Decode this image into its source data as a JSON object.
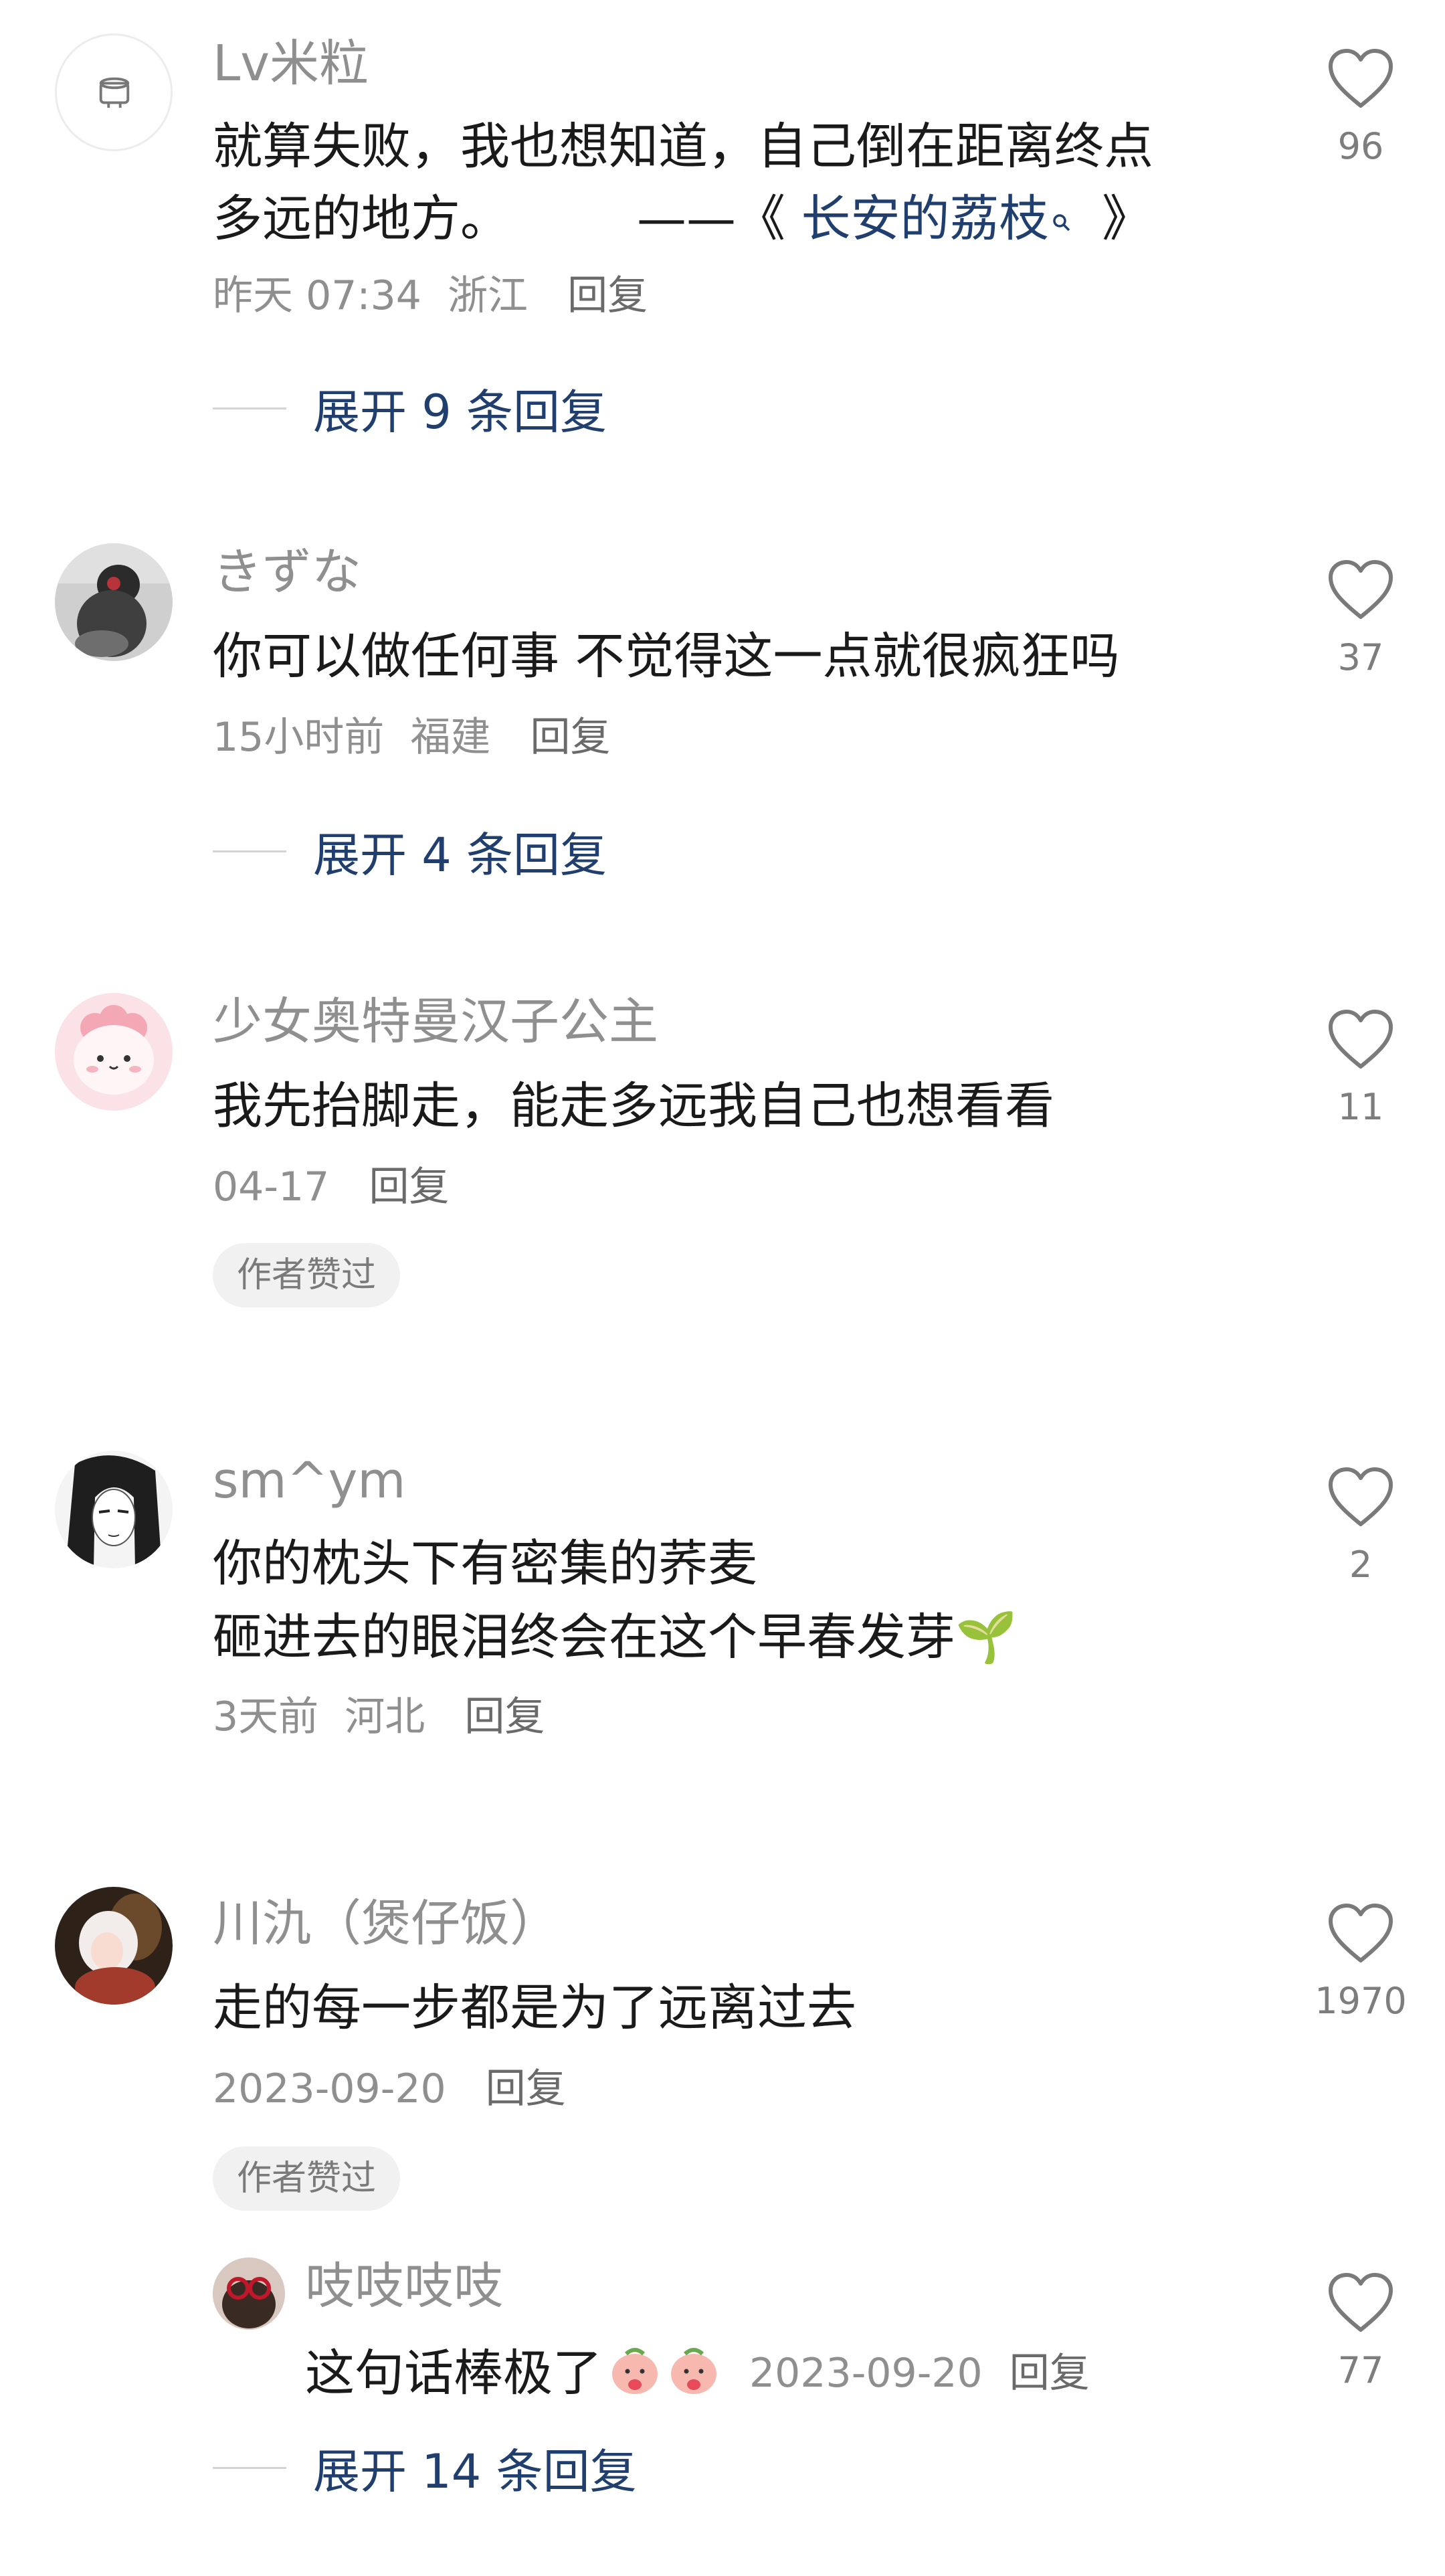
{
  "comments": [
    {
      "username": "Lv米粒",
      "line1": "就算失败，我也想知道，自己倒在距离终点",
      "line2_text": "多远的地方。",
      "line2_quote": "——《",
      "line2_link": "长安的荔枝",
      "line2_end": "》",
      "time": "昨天 07:34",
      "location": "浙江",
      "reply_label": "回复",
      "likes": "96",
      "expand": "展开 9 条回复"
    },
    {
      "username": "きずな",
      "line1": "你可以做任何事 不觉得这一点就很疯狂吗",
      "time": "15小时前",
      "location": "福建",
      "reply_label": "回复",
      "likes": "37",
      "expand": "展开 4 条回复"
    },
    {
      "username": "少女奥特曼汉子公主",
      "line1": "我先抬脚走，能走多远我自己也想看看",
      "time": "04-17",
      "reply_label": "回复",
      "badge": "作者赞过",
      "likes": "11"
    },
    {
      "username": "sm^ym",
      "line1": "你的枕头下有密集的荞麦",
      "line2": "砸进去的眼泪终会在这个早春发芽🌱",
      "time": "3天前",
      "location": "河北",
      "reply_label": "回复",
      "likes": "2"
    },
    {
      "username": "川氿（煲仔饭）",
      "line1": "走的每一步都是为了远离过去",
      "time": "2023-09-20",
      "reply_label": "回复",
      "badge": "作者赞过",
      "likes": "1970",
      "reply": {
        "username": "吱吱吱吱",
        "text": "这句话棒极了",
        "time": "2023-09-20",
        "reply_label": "回复",
        "likes": "77"
      },
      "expand": "展开 14 条回复"
    }
  ],
  "icons": {
    "like": "heart-outline-icon",
    "search_hint": "search-icon",
    "emoji": "peach-emoji-icon"
  },
  "colors": {
    "link_blue": "#203f6e",
    "gray_text": "#8f8f8f",
    "body_text": "#1a1a1a"
  }
}
